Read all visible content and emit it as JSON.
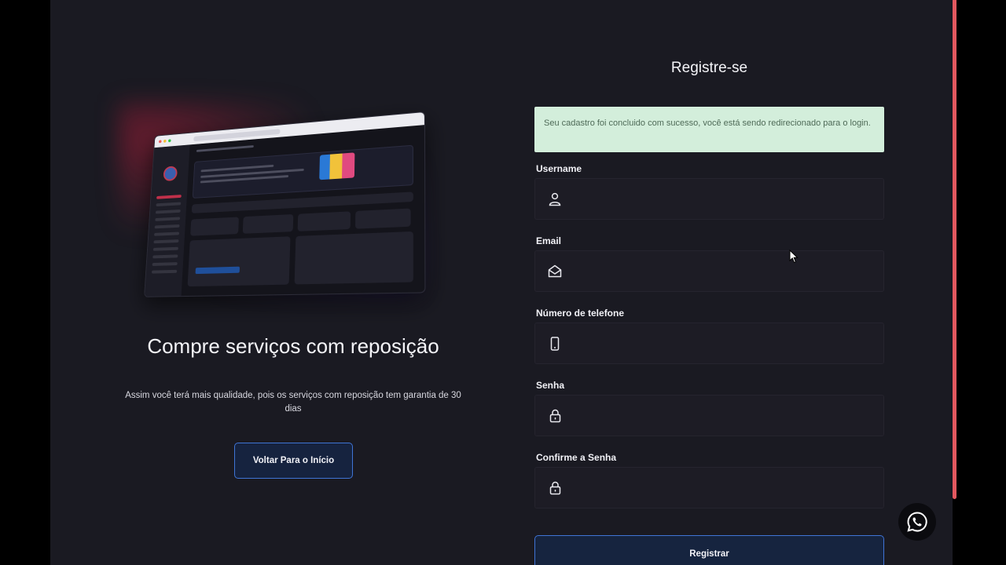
{
  "colors": {
    "accent": "#3f74d6",
    "success_bg": "#d3eedb",
    "page_bg": "#1a1a22",
    "scrollbar": "#e3585f"
  },
  "promo": {
    "title": "Compre serviços com reposição",
    "subtitle": "Assim você terá mais qualidade, pois os serviços com reposição tem garantia de 30 dias",
    "back_button": "Voltar Para o Início"
  },
  "form": {
    "title": "Registre-se",
    "alert": "Seu cadastro foi concluido com sucesso, você está sendo redirecionado para o login.",
    "fields": [
      {
        "label": "Username",
        "icon": "user-icon",
        "value": ""
      },
      {
        "label": "Email",
        "icon": "envelope-icon",
        "value": ""
      },
      {
        "label": "Número de telefone",
        "icon": "phone-icon",
        "value": ""
      },
      {
        "label": "Senha",
        "icon": "lock-icon",
        "value": ""
      },
      {
        "label": "Confirme a Senha",
        "icon": "lock-icon",
        "value": ""
      }
    ],
    "submit": "Registrar"
  },
  "widgets": {
    "whatsapp_icon": "whatsapp-icon"
  }
}
